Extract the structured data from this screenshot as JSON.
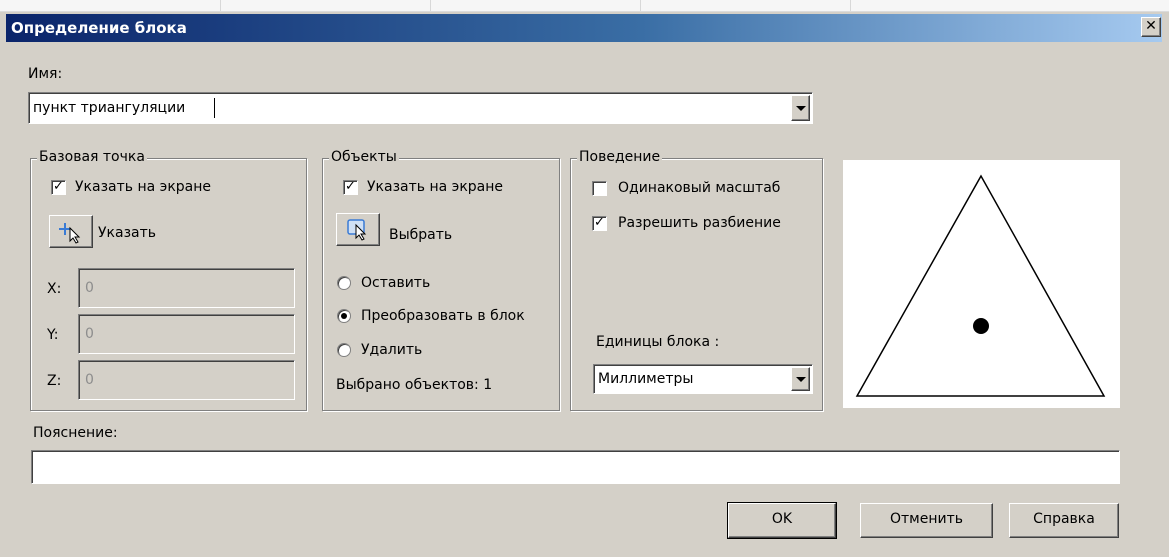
{
  "dialog": {
    "title": "Определение блока",
    "close_glyph": "✕"
  },
  "name": {
    "label": "Имя:",
    "value": "пункт триангуляции"
  },
  "base_point": {
    "title": "Базовая точка",
    "specify_on_screen": {
      "label": "Указать на экране",
      "checked": true
    },
    "pick_button": {
      "label": "Указать",
      "icon": "pick-point-icon"
    },
    "x": {
      "label": "X:",
      "value": "0"
    },
    "y": {
      "label": "Y:",
      "value": "0"
    },
    "z": {
      "label": "Z:",
      "value": "0"
    }
  },
  "objects": {
    "title": "Объекты",
    "specify_on_screen": {
      "label": "Указать на экране",
      "checked": true
    },
    "select_button": {
      "label": "Выбрать",
      "icon": "select-objects-icon"
    },
    "options": [
      {
        "label": "Оставить",
        "selected": false
      },
      {
        "label": "Преобразовать в блок",
        "selected": true
      },
      {
        "label": "Удалить",
        "selected": false
      }
    ],
    "selected_count": "Выбрано объектов: 1"
  },
  "behavior": {
    "title": "Поведение",
    "uniform_scale": {
      "label": "Одинаковый масштаб",
      "checked": false
    },
    "allow_explode": {
      "label": "Разрешить разбиение",
      "checked": true
    },
    "units_label": "Единицы блока :",
    "units_value": "Миллиметры"
  },
  "description": {
    "label": "Пояснение:",
    "value": ""
  },
  "buttons": {
    "ok": "OK",
    "cancel": "Отменить",
    "help": "Справка"
  },
  "colors": {
    "dialog_bg": "#d4d0c8",
    "title_start": "#0a246a",
    "title_end": "#a6caf0"
  }
}
